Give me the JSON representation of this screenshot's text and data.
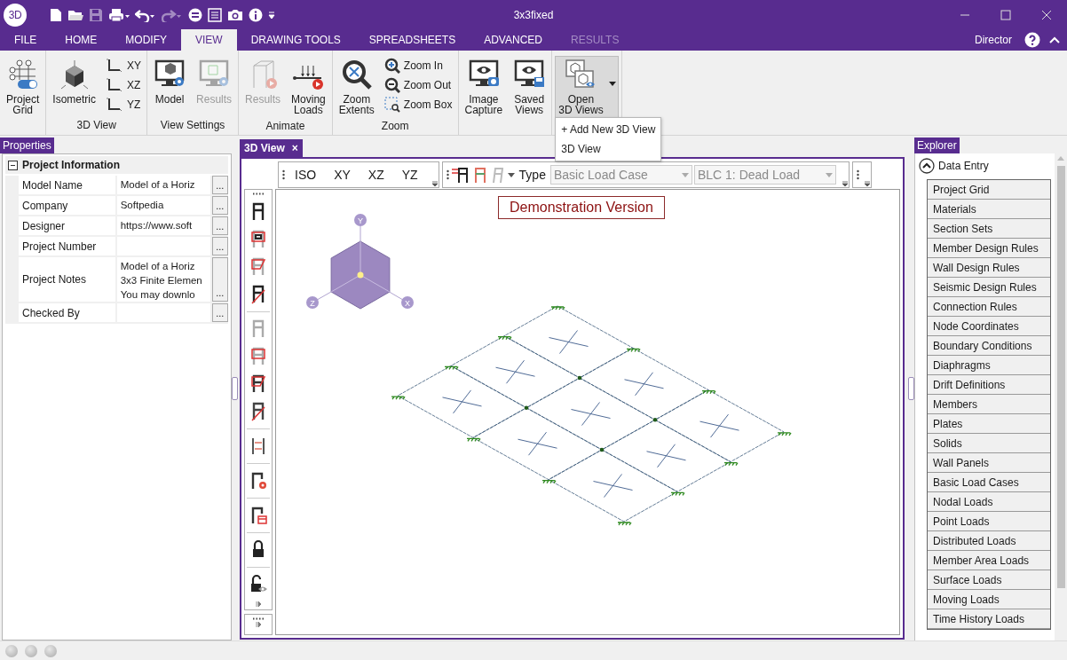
{
  "window": {
    "logo": "3D",
    "title": "3x3fixed"
  },
  "quick_access": [
    {
      "kind": "new",
      "disabled": false
    },
    {
      "kind": "open",
      "disabled": false
    },
    {
      "kind": "save",
      "disabled": true
    },
    {
      "kind": "print",
      "disabled": false
    },
    {
      "kind": "undo",
      "disabled": false
    },
    {
      "kind": "redo",
      "disabled": true
    },
    {
      "kind": "equal",
      "disabled": false
    },
    {
      "kind": "report",
      "disabled": false
    },
    {
      "kind": "camera",
      "disabled": false
    },
    {
      "kind": "info",
      "disabled": false
    },
    {
      "kind": "customize",
      "disabled": false
    }
  ],
  "menu_tabs": [
    {
      "label": "FILE",
      "selected": false,
      "disabled": false
    },
    {
      "label": "HOME",
      "selected": false,
      "disabled": false
    },
    {
      "label": "MODIFY",
      "selected": false,
      "disabled": false
    },
    {
      "label": "VIEW",
      "selected": true,
      "disabled": false
    },
    {
      "label": "DRAWING TOOLS",
      "selected": false,
      "disabled": false
    },
    {
      "label": "SPREADSHEETS",
      "selected": false,
      "disabled": false
    },
    {
      "label": "ADVANCED",
      "selected": false,
      "disabled": false
    },
    {
      "label": "RESULTS",
      "selected": false,
      "disabled": true
    }
  ],
  "user": "Director",
  "ribbon": [
    {
      "buttons": [
        {
          "kind": "grid",
          "label": "Project\nGrid",
          "compact": false,
          "disabled": false
        }
      ]
    },
    {
      "label": "3D View",
      "buttons": [
        {
          "kind": "iso",
          "label": "Isometric",
          "compact": false,
          "disabled": false
        },
        {
          "kind": "axes",
          "label": "XY",
          "compact": true,
          "disabled": false
        },
        {
          "kind": "axes",
          "label": "XZ",
          "compact": true,
          "disabled": false
        },
        {
          "kind": "axes",
          "label": "YZ",
          "compact": true,
          "disabled": false
        }
      ]
    },
    {
      "label": "View Settings",
      "buttons": [
        {
          "kind": "model",
          "label": "Model",
          "compact": false,
          "disabled": false
        },
        {
          "kind": "results",
          "label": "Results",
          "compact": false,
          "disabled": true
        }
      ]
    },
    {
      "label": "Animate",
      "buttons": [
        {
          "kind": "animate",
          "label": "Results",
          "compact": false,
          "disabled": true
        },
        {
          "kind": "moving",
          "label": "Moving\nLoads",
          "compact": false,
          "disabled": false
        }
      ]
    },
    {
      "label": "Zoom",
      "buttons": [
        {
          "kind": "extents",
          "label": "Zoom\nExtents",
          "compact": false,
          "disabled": false
        },
        {
          "kind": "zoomin",
          "label": "Zoom In",
          "compact": true,
          "disabled": false
        },
        {
          "kind": "zoomout",
          "label": "Zoom Out",
          "compact": true,
          "disabled": false
        },
        {
          "kind": "zoombox",
          "label": "Zoom Box",
          "compact": true,
          "disabled": false
        }
      ]
    },
    {
      "buttons": [
        {
          "kind": "capture",
          "label": "Image\nCapture",
          "compact": false,
          "disabled": false
        },
        {
          "kind": "saved",
          "label": "Saved\nViews",
          "compact": false,
          "disabled": false
        }
      ]
    },
    {
      "buttons": [
        {
          "kind": "open3d",
          "label": "Open\n3D Views",
          "compact": false,
          "disabled": false,
          "pressed": true,
          "open": true,
          "menu": [
            "+ Add New 3D View",
            "3D View"
          ]
        }
      ]
    }
  ],
  "properties": {
    "title": "Properties",
    "section": {
      "label": "Project Information",
      "expanded": true,
      "rows": [
        {
          "name": "Model Name",
          "lines": [
            "Model of a Horiz"
          ],
          "button": "..."
        },
        {
          "name": "Company",
          "lines": [
            "Softpedia"
          ],
          "button": "..."
        },
        {
          "name": "Designer",
          "lines": [
            "https://www.soft"
          ],
          "button": "..."
        },
        {
          "name": "Project Number",
          "lines": [],
          "button": "..."
        },
        {
          "name": "Project Notes",
          "lines": [
            "Model of a Horiz",
            "3x3 Finite Elemen",
            "You may downlo"
          ],
          "button": "..."
        },
        {
          "name": "Checked By",
          "lines": [],
          "button": "..."
        }
      ]
    }
  },
  "document_tabs": [
    {
      "label": "3D View",
      "selected": true,
      "close": "×"
    }
  ],
  "view_toolbar": {
    "views": [
      "ISO",
      "XY",
      "XZ",
      "YZ"
    ],
    "type_label": "Type",
    "type_combo": {
      "value": "Basic Load Case",
      "disabled": true
    },
    "case_combo": {
      "value": "BLC 1: Dead Load",
      "disabled": true
    }
  },
  "canvas": {
    "demo_label": "Demonstration Version",
    "axes": [
      "Y",
      "Z",
      "X"
    ]
  },
  "explorer": {
    "title": "Explorer",
    "group": {
      "label": "Data Entry",
      "expanded": true,
      "items": [
        "Project Grid",
        "Materials",
        "Section Sets",
        "Member Design Rules",
        "Wall Design Rules",
        "Seismic Design Rules",
        "Connection Rules",
        "Node Coordinates",
        "Boundary Conditions",
        "Diaphragms",
        "Drift Definitions",
        "Members",
        "Plates",
        "Solids",
        "Wall Panels",
        "Basic Load Cases",
        "Nodal Loads",
        "Point Loads",
        "Distributed Loads",
        "Member Area Loads",
        "Surface Loads",
        "Moving Loads",
        "Time History Loads"
      ]
    }
  }
}
